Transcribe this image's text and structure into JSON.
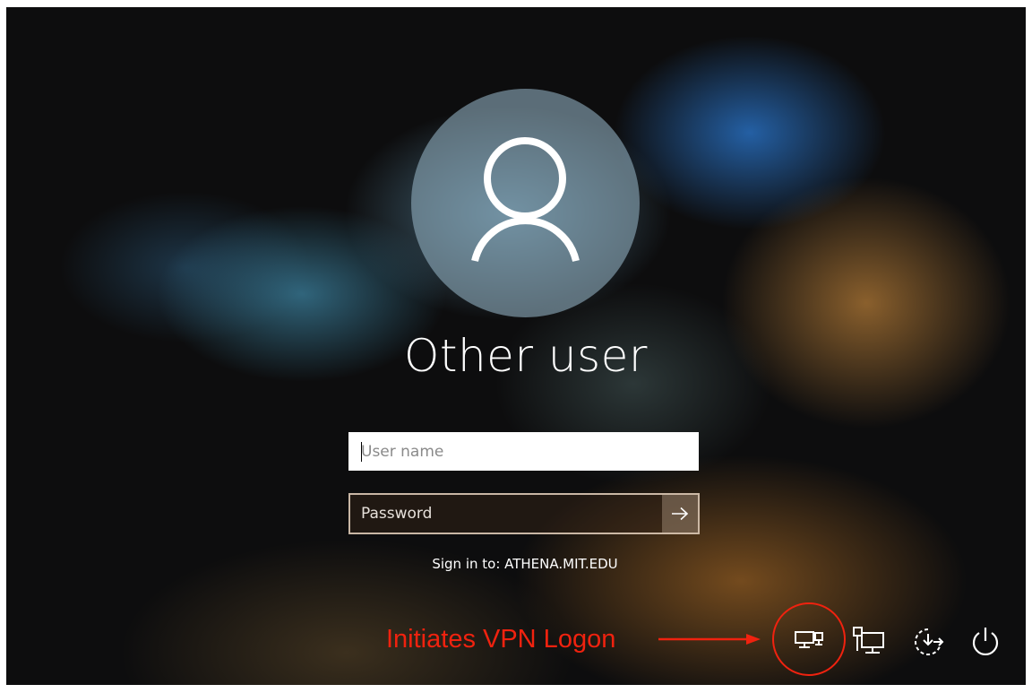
{
  "user": {
    "display_name": "Other user"
  },
  "login_form": {
    "username_placeholder": "User name",
    "password_placeholder": "Password",
    "submit_icon": "arrow-right-icon",
    "sign_in_text": "Sign in to: ATHENA.MIT.EDU"
  },
  "annotation": {
    "label": "Initiates VPN Logon",
    "color": "#f0220f"
  },
  "system_icons": [
    {
      "name": "network-sign-in-icon"
    },
    {
      "name": "network-icon"
    },
    {
      "name": "ease-of-access-icon"
    },
    {
      "name": "power-icon"
    }
  ]
}
